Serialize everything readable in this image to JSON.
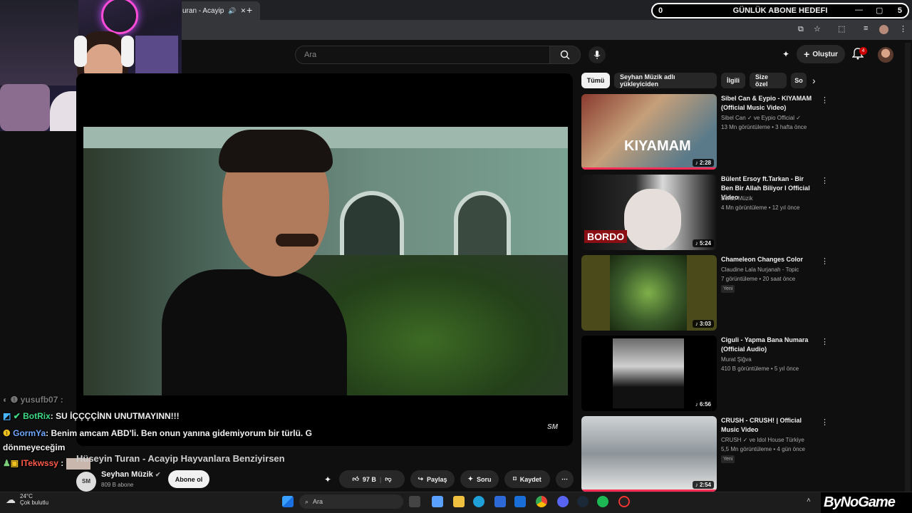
{
  "browser": {
    "tab_title": "uran - Acayip",
    "new_tab_label": "+",
    "window_controls": [
      "—",
      "▢",
      "✕"
    ]
  },
  "overlay": {
    "goal_left": "0",
    "goal_title": "GÜNLÜK ABONE HEDEFI",
    "goal_right": "5",
    "brand": "ByNoGame"
  },
  "youtube": {
    "search_placeholder": "Ara",
    "create_label": "Oluştur",
    "notification_count": "4"
  },
  "video": {
    "title": "Hüseyin Turan - Acayip Hayvanlara Benziyirsen",
    "watermark": "SM",
    "channel_name": "Seyhan Müzik",
    "channel_logo_text": "SM",
    "subscribers": "809 B abone",
    "subscribe_label": "Abone ol",
    "likes": "97 B",
    "share_label": "Paylaş",
    "ask_label": "Soru",
    "save_label": "Kaydet"
  },
  "chat": [
    {
      "user": "yusufb07",
      "message": ":"
    },
    {
      "user": "BotRix",
      "message": ": SU İÇÇÇÇİNN UNUTMAYINN!!!"
    },
    {
      "user": "GormYa",
      "message": ": Benim amcam ABD'li. Ben onun yanına gidemiyorum bir türlü. G"
    },
    {
      "user": "",
      "message": "dönmeyeceğim"
    },
    {
      "user": "ITekwssy",
      "message": ":"
    }
  ],
  "chips": [
    "Tümü",
    "Seyhan Müzik adlı yükleyiciden",
    "İlgili",
    "Size özel",
    "So"
  ],
  "recommendations": [
    {
      "title": "Sibel Can & Eypio - KIYAMAM (Official Music Video)",
      "channel": "Sibel Can ✓ ve Eypio Official ✓",
      "meta": "13 Mn görüntüleme • 3 hafta önce",
      "duration": "2:28",
      "thumb_text": "KIYAMAM",
      "badge": ""
    },
    {
      "title": "Bülent Ersoy ft.Tarkan - Bir Ben Bir Allah Biliyor I Official Video",
      "channel": "Bordo Müzik",
      "meta": "4 Mn görüntüleme • 12 yıl önce",
      "duration": "5:24",
      "thumb_text": "BORDO",
      "badge": ""
    },
    {
      "title": "Chameleon Changes Color",
      "channel": "Claudine Lala Nurjanah - Topic",
      "meta": "7 görüntüleme • 20 saat önce",
      "duration": "3:03",
      "thumb_text": "",
      "badge": "Yeni"
    },
    {
      "title": "Ciguli - Yapma Bana Numara (Official Audio)",
      "channel": "Murat Şiğva",
      "meta": "410 B görüntüleme • 5 yıl önce",
      "duration": "6:56",
      "thumb_text": "",
      "badge": ""
    },
    {
      "title": "CRUSH - CRUSH! | Official Music Video",
      "channel": "CRUSH ✓ ve Idol House Türkiye",
      "meta": "5,5 Mn görüntüleme • 4 gün önce",
      "duration": "2:54",
      "thumb_text": "",
      "badge": "Yeni"
    }
  ],
  "taskbar": {
    "temperature": "24°C",
    "weather": "Çok bulutlu",
    "search_label": "Ara"
  },
  "colors": {
    "accent_red": "#cc0000",
    "botrix_green": "#3ddc84",
    "gormya_blue": "#6fa8ff",
    "itekwssy_red": "#ff5a4a"
  }
}
